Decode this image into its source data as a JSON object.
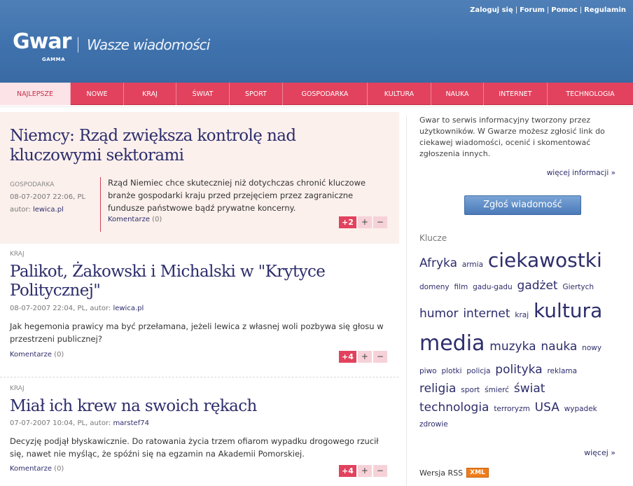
{
  "header": {
    "top_links": [
      "Zaloguj się",
      "Forum",
      "Pomoc",
      "Regulamin"
    ],
    "logo": "Gwar",
    "logo_sub": "GAMMA",
    "slogan": "Wasze wiadomości"
  },
  "nav": {
    "items": [
      "NAJLEPSZE",
      "NOWE",
      "KRAJ",
      "ŚWIAT",
      "SPORT",
      "GOSPODARKA",
      "KULTURA",
      "NAUKA",
      "INTERNET",
      "TECHNOLOGIA"
    ],
    "active": "NAJLEPSZE"
  },
  "featured": {
    "title": "Niemcy: Rząd zwiększa kontrolę nad kluczowymi sektorami",
    "category": "GOSPODARKA",
    "date": "08-07-2007 22:06, PL",
    "author_label": "autor:",
    "author": "lewica.pl",
    "lead": "Rząd Niemiec chce skuteczniej niż dotychczas chronić kluczowe branże gospodarki kraju przed przejęciem przez zagraniczne fundusze państwowe bądź prywatne koncerny.",
    "comments_label": "Komentarze",
    "comments_count": "(0)",
    "score": "+2"
  },
  "articles": [
    {
      "category": "KRAJ",
      "title": "Palikot, Żakowski i Michalski w \"Krytyce Politycznej\"",
      "meta": "08-07-2007 22:04, PL, autor:",
      "author": "lewica.pl",
      "lead": "Jak hegemonia prawicy ma być przełamana, jeżeli lewica z własnej woli pozbywa się głosu w przestrzeni publicznej?",
      "comments_label": "Komentarze",
      "comments_count": "(0)",
      "score": "+4"
    },
    {
      "category": "KRAJ",
      "title": "Miał ich krew na swoich rękach",
      "meta": "07-07-2007 10:04, PL, autor:",
      "author": "marstef74",
      "lead": "Decyzję podjął błyskawicznie. Do ratowania życia trzem ofiarom wypadku drogowego rzucił się, nawet nie myśląc, że spóźni się na egzamin na Akademii Pomorskiej.",
      "comments_label": "Komentarze",
      "comments_count": "(0)",
      "score": "+4"
    }
  ],
  "vote": {
    "plus": "+",
    "minus": "−"
  },
  "sidebar": {
    "info": "Gwar to serwis informacyjny tworzony przez użytkowników. W Gwarze możesz zgłosić link do ciekawej wiadomości, ocenić i skomentować zgłoszenia innych.",
    "more_info": "więcej informacji »",
    "report_button": "Zgłoś wiadomość",
    "tags_title": "Klucze",
    "tags": [
      {
        "text": "Afryka",
        "size": 4
      },
      {
        "text": "armia",
        "size": 1
      },
      {
        "text": "ciekawostki",
        "size": 5
      },
      {
        "text": "domeny",
        "size": 1
      },
      {
        "text": "film",
        "size": 1
      },
      {
        "text": "gadu-gadu",
        "size": 1
      },
      {
        "text": "gadżet",
        "size": 4
      },
      {
        "text": "Giertych",
        "size": 1
      },
      {
        "text": "humor",
        "size": 4
      },
      {
        "text": "internet",
        "size": 4
      },
      {
        "text": "kraj",
        "size": 1
      },
      {
        "text": "kultura",
        "size": 5
      },
      {
        "text": "media",
        "size": 6
      },
      {
        "text": "muzyka",
        "size": 4
      },
      {
        "text": "nauka",
        "size": 4
      },
      {
        "text": "nowy",
        "size": 1
      },
      {
        "text": "piwo",
        "size": 1
      },
      {
        "text": "plotki",
        "size": 1
      },
      {
        "text": "policja",
        "size": 1
      },
      {
        "text": "polityka",
        "size": 4
      },
      {
        "text": "reklama",
        "size": 1
      },
      {
        "text": "religia",
        "size": 4
      },
      {
        "text": "sport",
        "size": 1
      },
      {
        "text": "śmierć",
        "size": 1
      },
      {
        "text": "świat",
        "size": 4
      },
      {
        "text": "technologia",
        "size": 4
      },
      {
        "text": "terroryzm",
        "size": 1
      },
      {
        "text": "USA",
        "size": 4
      },
      {
        "text": "wypadek",
        "size": 1
      },
      {
        "text": "zdrowie",
        "size": 1
      }
    ],
    "more_tags": "więcej »",
    "rss_label": "Wersja RSS",
    "xml_badge": "XML"
  }
}
